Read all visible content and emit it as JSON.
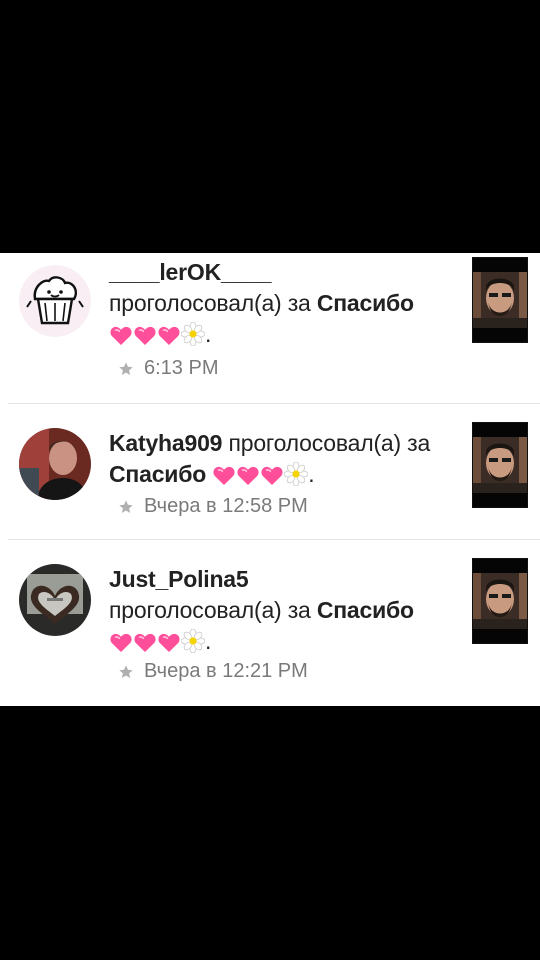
{
  "notifications": [
    {
      "username": "____lerOK____",
      "action_before": " проголосовал(а) за ",
      "target": "Спасибо",
      "emoji": "hearts-flower",
      "period": ".",
      "time": "6:13 PM",
      "avatar": "muffin-avatar"
    },
    {
      "username": "Katyha909",
      "action_before": " проголосовал(а) за ",
      "target": "Спасибо",
      "emoji": "hearts-flower",
      "period": ".",
      "time": "Вчера в 12:58 PM",
      "avatar": "person-avatar"
    },
    {
      "username": "Just_Polina5",
      "action_before": " проголосовал(а) за ",
      "target": "Спасибо",
      "emoji": "hearts-flower",
      "period": ".",
      "time": "Вчера в 12:21 PM",
      "avatar": "heart-hands-avatar"
    }
  ],
  "colors": {
    "heart": "#ff4f9a",
    "heart_light": "#ffb3d4",
    "flower_center": "#f5d300"
  }
}
